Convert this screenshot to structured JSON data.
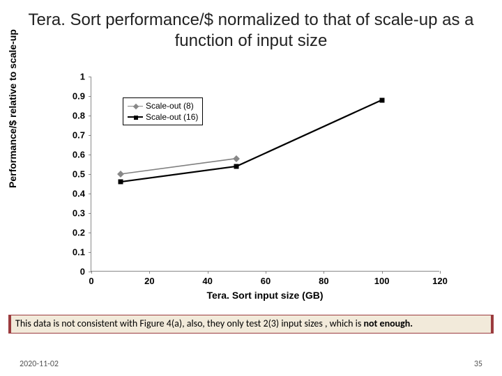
{
  "title": "Tera. Sort performance/$ normalized to that of scale-up as a function of input size",
  "chart_data": {
    "type": "line",
    "title": "Tera. Sort performance/$ normalized to that of scale-up as a function of input size",
    "xlabel": "Tera. Sort input size (GB)",
    "ylabel": "Performance/$ relative to scale-up",
    "xlim": [
      0,
      120
    ],
    "ylim": [
      0,
      1
    ],
    "xticks": [
      0,
      20,
      40,
      60,
      80,
      100,
      120
    ],
    "yticks": [
      0,
      0.1,
      0.2,
      0.3,
      0.4,
      0.5,
      0.6,
      0.7,
      0.8,
      0.9,
      1
    ],
    "series": [
      {
        "name": "Scale-out (8)",
        "color": "#808080",
        "marker": "diamond",
        "x": [
          10,
          50
        ],
        "y": [
          0.5,
          0.58
        ]
      },
      {
        "name": "Scale-out (16)",
        "color": "#000000",
        "marker": "square",
        "x": [
          10,
          50,
          100
        ],
        "y": [
          0.46,
          0.54,
          0.88
        ]
      }
    ],
    "legend_position": "upper-left-inside"
  },
  "note_text_prefix": "This data is not consistent with Figure 4(a), also, they only test 2(3) input sizes , which is ",
  "note_text_bold": "not enough.",
  "footer_date": "2020-11-02",
  "footer_page": "35"
}
